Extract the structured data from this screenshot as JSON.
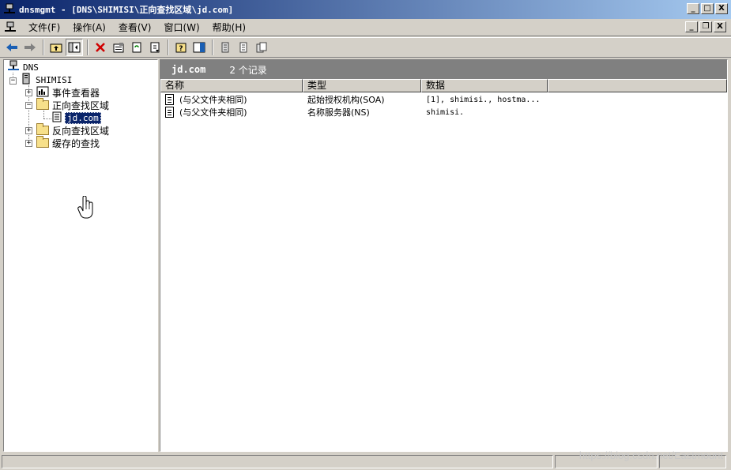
{
  "window": {
    "title": "dnsmgmt - [DNS\\SHIMISI\\正向查找区域\\jd.com]",
    "buttons": {
      "minimize": "_",
      "maximize": "□",
      "close": "X"
    }
  },
  "menubar": {
    "items": [
      "文件(F)",
      "操作(A)",
      "查看(V)",
      "窗口(W)",
      "帮助(H)"
    ],
    "mdi_buttons": {
      "minimize": "_",
      "restore": "❐",
      "close": "X"
    }
  },
  "toolbar": {
    "icons": [
      "back-arrow-icon",
      "forward-arrow-icon",
      "up-folder-icon",
      "show-tree-icon",
      "delete-icon",
      "properties-icon",
      "refresh-icon",
      "export-icon",
      "help-icon",
      "console-icon",
      "new-record-icon",
      "new-record2-icon",
      "new-domain-icon"
    ],
    "colors": {
      "back": "#1a5fb4",
      "delete": "#d00000"
    }
  },
  "tree": {
    "root": "DNS",
    "server": "SHIMISI",
    "nodes": [
      "事件查看器",
      "正向查找区域",
      "jd.com",
      "反向查找区域",
      "缓存的查找"
    ],
    "selected": "jd.com"
  },
  "details": {
    "zone": "jd.com",
    "record_count": "2 个记录",
    "columns": [
      "名称",
      "类型",
      "数据"
    ],
    "rows": [
      {
        "name": "(与父文件夹相同)",
        "type": "起始授权机构(SOA)",
        "data": "[1], shimisi., hostma..."
      },
      {
        "name": "(与父文件夹相同)",
        "type": "名称服务器(NS)",
        "data": "shimisi."
      }
    ]
  },
  "watermark": "https://blog.csdn.net/Eastmount"
}
